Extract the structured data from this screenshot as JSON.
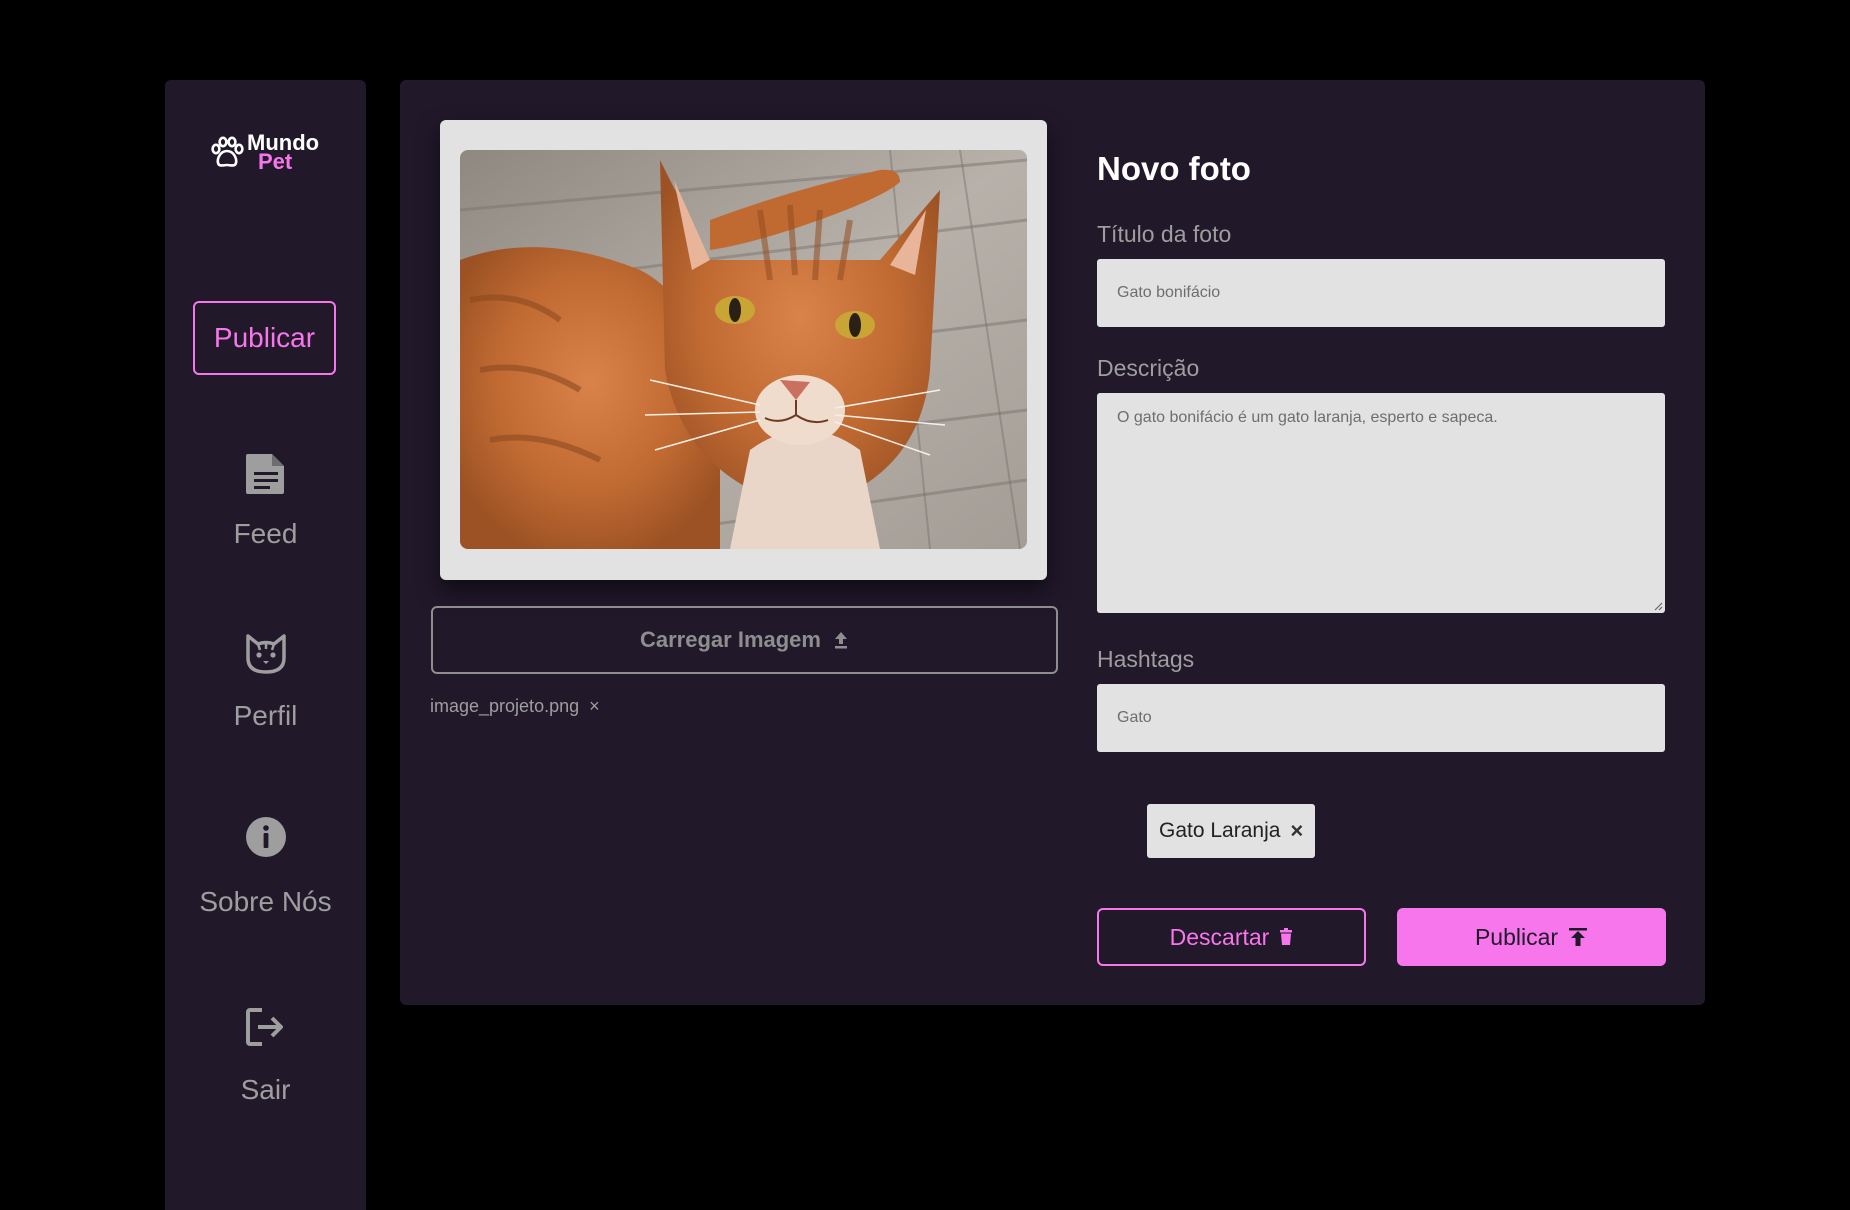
{
  "brand": {
    "line1": "Mundo",
    "line2": "Pet",
    "accent": "#f876ec",
    "background": "#21182a"
  },
  "sidebar": {
    "publish_label": "Publicar",
    "items": [
      {
        "label": "Feed",
        "icon": "document-icon"
      },
      {
        "label": "Perfil",
        "icon": "cat-face-icon"
      },
      {
        "label": "Sobre Nós",
        "icon": "info-icon"
      },
      {
        "label": "Sair",
        "icon": "logout-icon"
      }
    ]
  },
  "upload": {
    "button_label": "Carregar Imagem",
    "filename": "image_projeto.png",
    "remove_symbol": "×"
  },
  "form": {
    "title": "Novo foto",
    "title_label": "Título da foto",
    "title_value": "Gato bonifácio",
    "description_label": "Descrição",
    "description_value": "O gato bonifácio é um gato laranja, esperto e sapeca.",
    "hashtags_label": "Hashtags",
    "hashtags_value": "Gato",
    "tags": [
      {
        "label": "Gato Laranja",
        "remove": "×"
      }
    ],
    "discard_label": "Descartar",
    "publish_label": "Publicar"
  }
}
